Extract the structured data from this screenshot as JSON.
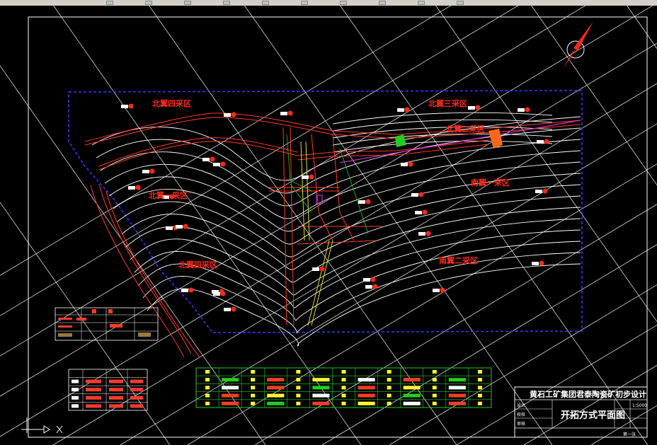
{
  "window": {
    "toolbar_icons": [
      "new-icon",
      "open-icon",
      "save-icon",
      "print-icon",
      "undo-icon",
      "redo-icon",
      "pan-icon",
      "zoom-icon",
      "layer-icon",
      "properties-icon"
    ]
  },
  "drawing": {
    "zones": [
      {
        "id": "north-4",
        "label": "北翼四采区"
      },
      {
        "id": "north-3",
        "label": "北翼三采区"
      },
      {
        "id": "north-2",
        "label": "北翼二采区"
      },
      {
        "id": "north-1",
        "label": "北翼一采区"
      },
      {
        "id": "north-4b",
        "label": "北翼四采区"
      },
      {
        "id": "south-1",
        "label": "南翼一采区"
      },
      {
        "id": "south-2",
        "label": "南翼二采区"
      }
    ],
    "colors": {
      "background": "#000000",
      "contour": "#ffffff",
      "boundary": "#3a3aff",
      "roadway": "#ff3b2a",
      "label": "#ff2a1a",
      "highlight": "#22cc22",
      "grid": "#ffffff"
    }
  },
  "title_block": {
    "company": "黄石工矿集团君泰陶瓷矿初步设计",
    "drawing_name": "开拓方式平面图",
    "fields": [
      {
        "label": "设计",
        "value": ""
      },
      {
        "label": "校核",
        "value": ""
      },
      {
        "label": "审核",
        "value": ""
      }
    ],
    "scale": "1:5000",
    "sheet": "第一张"
  }
}
